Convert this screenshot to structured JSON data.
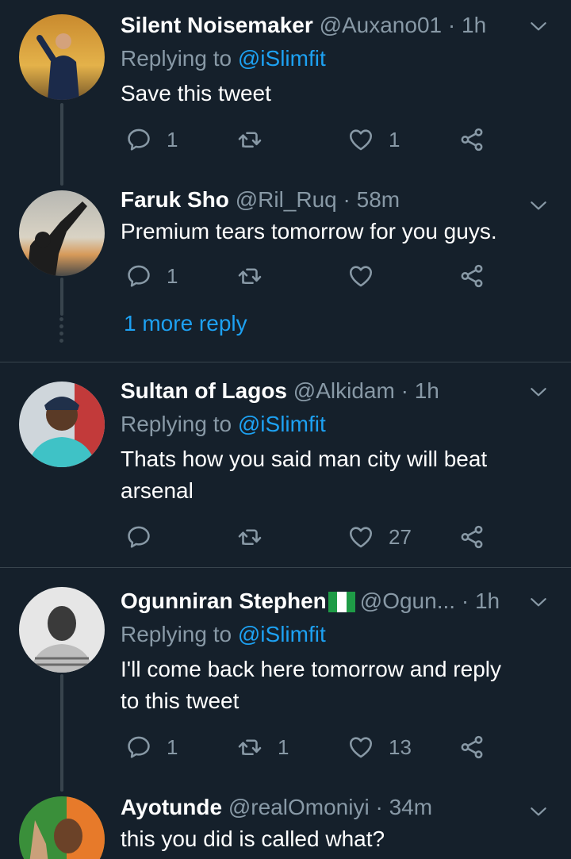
{
  "replies": [
    {
      "name": "Silent Noisemaker",
      "handle": "@Auxano01",
      "time": "1h",
      "replying_prefix": "Replying to ",
      "replying_to": "@iSlimfit",
      "text": "Save this tweet",
      "reply_count": "1",
      "retweet_count": "",
      "like_count": "1"
    },
    {
      "name": "Faruk Sho",
      "handle": "@Ril_Ruq",
      "time": "58m",
      "text": "Premium tears tomorrow for you guys.",
      "reply_count": "1",
      "retweet_count": "",
      "like_count": "",
      "more_replies": "1 more reply"
    },
    {
      "name": "Sultan of Lagos",
      "handle": "@Alkidam",
      "time": "1h",
      "replying_prefix": "Replying to ",
      "replying_to": "@iSlimfit",
      "text_line1": "Thats how you said man city will beat",
      "text_line2": "arsenal",
      "reply_count": "",
      "retweet_count": "",
      "like_count": "27"
    },
    {
      "name": "Ogunniran Stephen",
      "handle": "@Ogun...",
      "time": "1h",
      "replying_prefix": "Replying to ",
      "replying_to": "@iSlimfit",
      "text_line1": "I'll come back here tomorrow and reply",
      "text_line2": "to this tweet",
      "reply_count": "1",
      "retweet_count": "1",
      "like_count": "13"
    },
    {
      "name": "Ayotunde",
      "handle": "@realOmoniyi",
      "time": "34m",
      "text": "this you did is called what?"
    }
  ],
  "separator": " · ",
  "colors": {
    "background": "#15202b",
    "accent": "#1da1f2",
    "secondary_text": "#8899a6",
    "divider": "#38444d"
  },
  "icons": {
    "reply": "reply-icon",
    "retweet": "retweet-icon",
    "like": "heart-icon",
    "share": "share-icon",
    "menu": "chevron-down-icon"
  }
}
